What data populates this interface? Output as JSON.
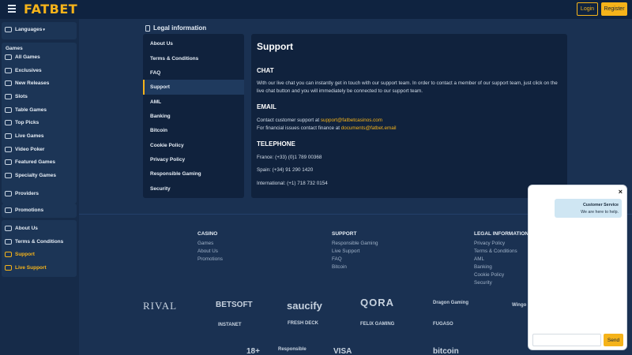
{
  "header": {
    "logo": "FATBET",
    "login_label": "Login",
    "register_label": "Register"
  },
  "sidebar": {
    "languages": "Languages",
    "games_heading": "Games",
    "games": [
      {
        "label": "All Games",
        "icon": "all-games-icon"
      },
      {
        "label": "Exclusives",
        "icon": "exclusives-icon"
      },
      {
        "label": "New Releases",
        "icon": "new-releases-icon"
      },
      {
        "label": "Slots",
        "icon": "slots-icon"
      },
      {
        "label": "Table Games",
        "icon": "table-games-icon"
      },
      {
        "label": "Top Picks",
        "icon": "top-picks-icon"
      },
      {
        "label": "Live Games",
        "icon": "live-games-icon"
      },
      {
        "label": "Video Poker",
        "icon": "video-poker-icon"
      },
      {
        "label": "Featured Games",
        "icon": "featured-games-icon"
      },
      {
        "label": "Specialty Games",
        "icon": "specialty-games-icon"
      }
    ],
    "providers": "Providers",
    "promotions": "Promotions",
    "info": [
      {
        "label": "About Us",
        "icon": "about-icon"
      },
      {
        "label": "Terms & Conditions",
        "icon": "terms-icon"
      },
      {
        "label": "Support",
        "icon": "support-icon"
      },
      {
        "label": "Live Support",
        "icon": "chat-icon"
      }
    ]
  },
  "legal": {
    "title": "Legal information",
    "menu": [
      "About Us",
      "Terms & Conditions",
      "FAQ",
      "Support",
      "AML",
      "Banking",
      "Bitcoin",
      "Cookie Policy",
      "Privacy Policy",
      "Responsible Gaming",
      "Security"
    ],
    "active": "Support"
  },
  "content": {
    "title": "Support",
    "chat_heading": "CHAT",
    "chat_text": "With our live chat you can instantly get in touch with our support team. In order to contact a member of our support team, just click on the live chat button and you will immediately be connected to our support team.",
    "email_heading": "EMAIL",
    "email_line1_prefix": "Contact customer support at ",
    "email_support": "support@fatbetcasinos.com",
    "email_line2_prefix": "For financial issues contact finance at ",
    "email_finance": "documents@fatbet.email",
    "phone_heading": "TELEPHONE",
    "phone_france": "France: (+33) (0)1 789 00368",
    "phone_spain": "Spain: (+34) 91 290 1420",
    "phone_international": "International: (+1) 718 732 0154"
  },
  "footer": {
    "casino": {
      "heading": "CASINO",
      "links": [
        "Games",
        "About Us",
        "Promotions"
      ]
    },
    "support": {
      "heading": "SUPPORT",
      "links": [
        "Responsible Gaming",
        "Live Support",
        "FAQ",
        "Bitcoin"
      ]
    },
    "legal": {
      "heading": "LEGAL INFORMATION",
      "links": [
        "Privacy Policy",
        "Terms & Conditions",
        "AML",
        "Banking",
        "Cookie Policy",
        "Security"
      ]
    },
    "providers": [
      "RIVAL",
      "BETSOFT",
      "saucify",
      "QORA",
      "Dragon Gaming",
      "Wingo",
      "INSTANET",
      "FRESH DECK",
      "FELIX GAMING",
      "FUGASO"
    ],
    "badges": [
      "18+",
      "Responsible",
      "VISA",
      "bitcoin"
    ]
  },
  "chat_widget": {
    "close": "×",
    "agent_name": "Customer Service",
    "agent_message": "We are here to help.",
    "send_label": "Send"
  }
}
